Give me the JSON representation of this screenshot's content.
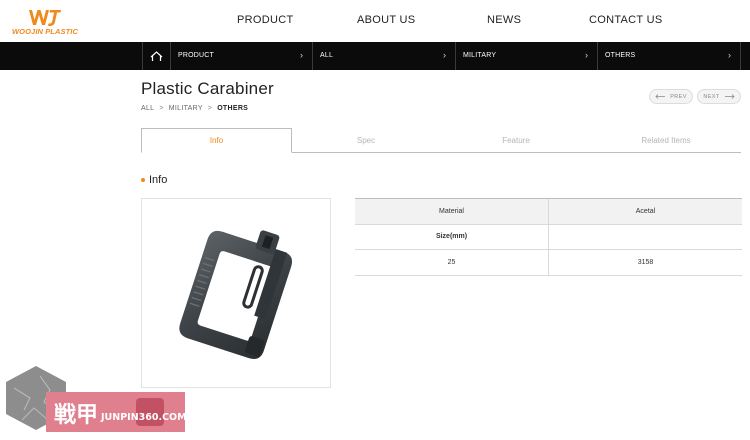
{
  "brand": {
    "name": "WOOJIN PLASTIC",
    "color": "#f08a1c"
  },
  "nav": {
    "items": [
      {
        "label": "PRODUCT"
      },
      {
        "label": "ABOUT US"
      },
      {
        "label": "NEWS"
      },
      {
        "label": "CONTACT US"
      }
    ]
  },
  "category_bar": {
    "home_icon": "home-icon",
    "cells": [
      {
        "label": "PRODUCT"
      },
      {
        "label": "ALL"
      },
      {
        "label": "MILITARY"
      },
      {
        "label": "OTHERS"
      }
    ],
    "chevron": "›"
  },
  "product": {
    "title": "Plastic Carabiner",
    "breadcrumb": [
      "ALL",
      "MILITARY",
      "OTHERS"
    ],
    "breadcrumb_sep": ">"
  },
  "pager": {
    "prev_label": "PREV",
    "next_label": "NEXT"
  },
  "tabs": [
    {
      "label": "Info",
      "active": true
    },
    {
      "label": "Spec",
      "active": false
    },
    {
      "label": "Feature",
      "active": false
    },
    {
      "label": "Related Items",
      "active": false
    }
  ],
  "info": {
    "heading": "Info",
    "table": {
      "rows": [
        [
          "Material",
          "Acetal"
        ],
        [
          "Size(mm)",
          ""
        ],
        [
          "25",
          "3158"
        ]
      ]
    }
  },
  "watermark": {
    "text": "戦甲",
    "sub": "JUNPIN360.COM"
  }
}
